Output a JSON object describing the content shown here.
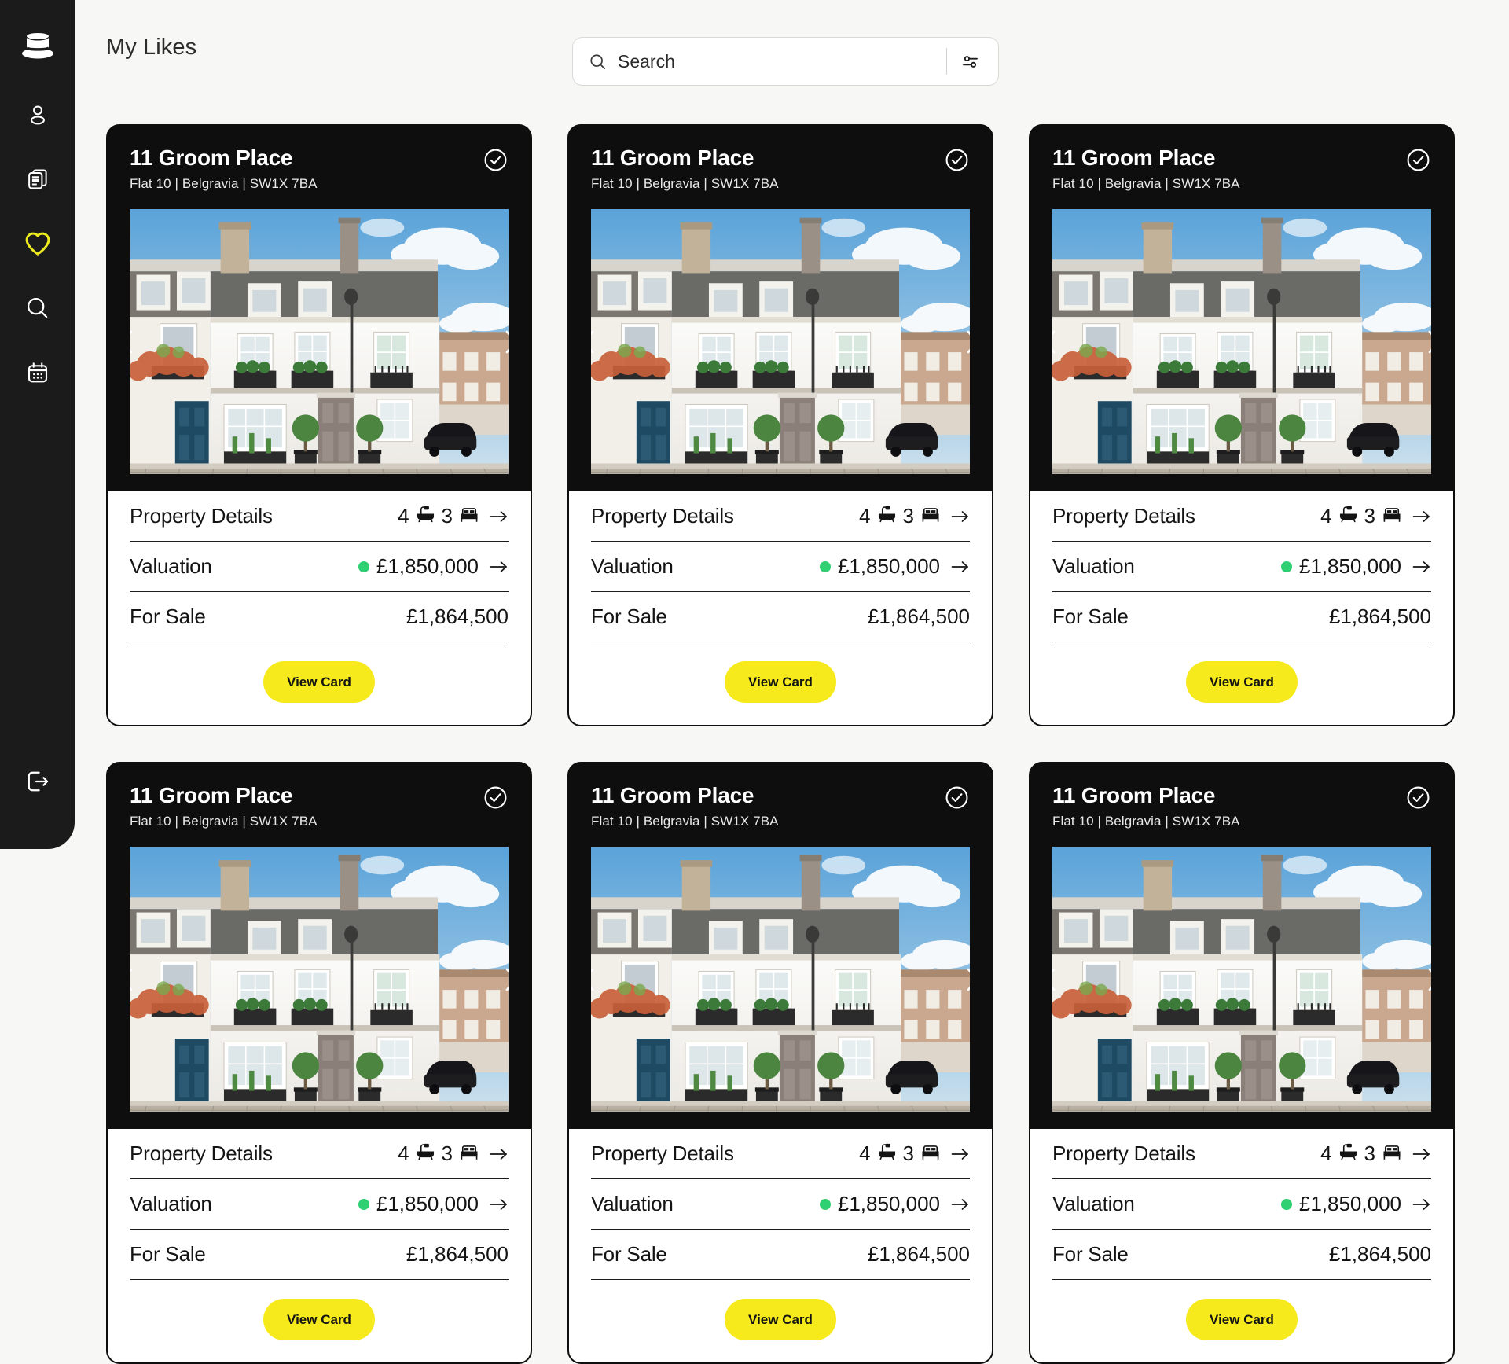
{
  "colors": {
    "sidebar_bg": "#1b1b1b",
    "page_bg": "#f7f7f6",
    "card_dark": "#0e0e0e",
    "accent_yellow": "#f6ea1c",
    "status_green": "#2fd071"
  },
  "sidebar": {
    "logo": "top-hat-logo",
    "items": [
      {
        "name": "profile",
        "icon": "user-icon",
        "active": false
      },
      {
        "name": "documents",
        "icon": "documents-icon",
        "active": false
      },
      {
        "name": "likes",
        "icon": "heart-icon",
        "active": true
      },
      {
        "name": "search",
        "icon": "search-icon",
        "active": false
      },
      {
        "name": "calendar",
        "icon": "calendar-icon",
        "active": false
      }
    ],
    "logout": {
      "name": "logout",
      "icon": "logout-icon"
    }
  },
  "header": {
    "title": "My Likes"
  },
  "search": {
    "placeholder": "Search",
    "value": "",
    "icon": "search-icon",
    "filter_icon": "filter-sliders-icon"
  },
  "cards": [
    {
      "title": "11 Groom Place",
      "subtitle": "Flat 10 | Belgravia | SW1X 7BA",
      "liked": true,
      "photo_alt": "white-mews-house-exterior",
      "rows": {
        "details_label": "Property Details",
        "baths": "4",
        "beds": "3",
        "valuation_label": "Valuation",
        "valuation_value": "£1,850,000",
        "forsale_label": "For Sale",
        "forsale_value": "£1,864,500"
      },
      "cta": "View Card"
    },
    {
      "title": "11 Groom Place",
      "subtitle": "Flat 10 | Belgravia | SW1X 7BA",
      "liked": true,
      "photo_alt": "white-mews-house-exterior",
      "rows": {
        "details_label": "Property Details",
        "baths": "4",
        "beds": "3",
        "valuation_label": "Valuation",
        "valuation_value": "£1,850,000",
        "forsale_label": "For Sale",
        "forsale_value": "£1,864,500"
      },
      "cta": "View Card"
    },
    {
      "title": "11 Groom Place",
      "subtitle": "Flat 10 | Belgravia | SW1X 7BA",
      "liked": true,
      "photo_alt": "white-mews-house-exterior",
      "rows": {
        "details_label": "Property Details",
        "baths": "4",
        "beds": "3",
        "valuation_label": "Valuation",
        "valuation_value": "£1,850,000",
        "forsale_label": "For Sale",
        "forsale_value": "£1,864,500"
      },
      "cta": "View Card"
    },
    {
      "title": "11 Groom Place",
      "subtitle": "Flat 10 | Belgravia | SW1X 7BA",
      "liked": true,
      "photo_alt": "white-mews-house-exterior",
      "rows": {
        "details_label": "Property Details",
        "baths": "4",
        "beds": "3",
        "valuation_label": "Valuation",
        "valuation_value": "£1,850,000",
        "forsale_label": "For Sale",
        "forsale_value": "£1,864,500"
      },
      "cta": "View Card"
    },
    {
      "title": "11 Groom Place",
      "subtitle": "Flat 10 | Belgravia | SW1X 7BA",
      "liked": true,
      "photo_alt": "white-mews-house-exterior",
      "rows": {
        "details_label": "Property Details",
        "baths": "4",
        "beds": "3",
        "valuation_label": "Valuation",
        "valuation_value": "£1,850,000",
        "forsale_label": "For Sale",
        "forsale_value": "£1,864,500"
      },
      "cta": "View Card"
    },
    {
      "title": "11 Groom Place",
      "subtitle": "Flat 10 | Belgravia | SW1X 7BA",
      "liked": true,
      "photo_alt": "white-mews-house-exterior",
      "rows": {
        "details_label": "Property Details",
        "baths": "4",
        "beds": "3",
        "valuation_label": "Valuation",
        "valuation_value": "£1,850,000",
        "forsale_label": "For Sale",
        "forsale_value": "£1,864,500"
      },
      "cta": "View Card"
    }
  ]
}
